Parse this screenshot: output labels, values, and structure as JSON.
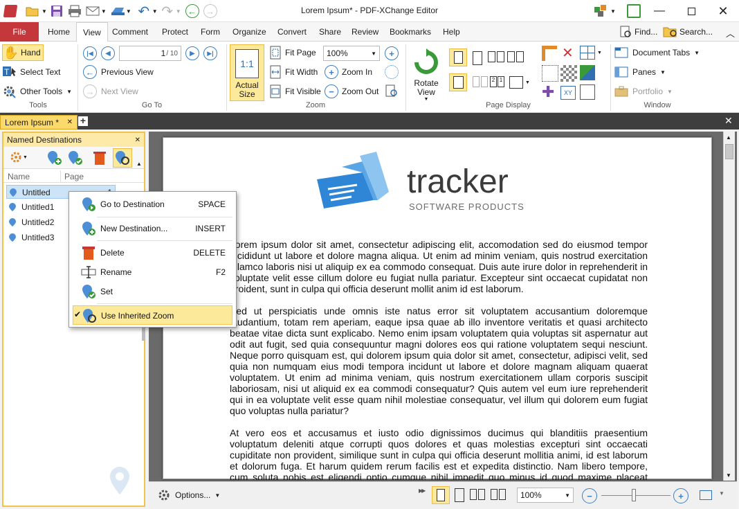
{
  "window": {
    "title": "Lorem Ipsum* - PDF-XChange Editor"
  },
  "ribbon_tabs": [
    "File",
    "Home",
    "View",
    "Comment",
    "Protect",
    "Form",
    "Organize",
    "Convert",
    "Share",
    "Review",
    "Bookmarks",
    "Help"
  ],
  "ribbon_right": {
    "find": "Find...",
    "search": "Search..."
  },
  "tools": {
    "hand": "Hand",
    "select_text": "Select Text",
    "other_tools": "Other Tools",
    "label": "Tools"
  },
  "goto": {
    "page_value": "1",
    "page_total": "/ 10",
    "previous_view": "Previous View",
    "next_view": "Next View",
    "label": "Go To"
  },
  "zoom": {
    "actual_size": "Actual Size",
    "fit_page": "Fit Page",
    "fit_width": "Fit Width",
    "fit_visible": "Fit Visible",
    "zoom_value": "100%",
    "zoom_in": "Zoom In",
    "zoom_out": "Zoom Out",
    "label": "Zoom"
  },
  "page_display": {
    "rotate_view": "Rotate View",
    "label": "Page Display"
  },
  "window_group": {
    "document_tabs": "Document Tabs",
    "panes": "Panes",
    "portfolio": "Portfolio",
    "label": "Window"
  },
  "document_tab": {
    "label": "Lorem Ipsum *"
  },
  "named_destinations": {
    "title": "Named Destinations",
    "col_name": "Name",
    "col_page": "Page",
    "rows": [
      {
        "name": "Untitled",
        "page": "1"
      },
      {
        "name": "Untitled1",
        "page": ""
      },
      {
        "name": "Untitled2",
        "page": ""
      },
      {
        "name": "Untitled3",
        "page": ""
      }
    ]
  },
  "context_menu": {
    "items": [
      {
        "label": "Go to Destination",
        "shortcut": "SPACE"
      },
      {
        "label": "New Destination...",
        "shortcut": "INSERT"
      },
      {
        "label": "Delete",
        "shortcut": "DELETE"
      },
      {
        "label": "Rename",
        "shortcut": "F2"
      },
      {
        "label": "Set",
        "shortcut": ""
      },
      {
        "label": "Use Inherited Zoom",
        "shortcut": "",
        "checked": true
      }
    ]
  },
  "document": {
    "logo_word": "tracker",
    "logo_sub": "SOFTWARE PRODUCTS",
    "paragraphs": [
      "Lorem ipsum dolor sit amet, consectetur adipiscing elit, accomodation sed do eiusmod tempor incididunt ut labore et dolore magna aliqua. Ut enim ad minim veniam, quis nostrud exercitation ullamco laboris nisi ut aliquip ex ea commodo consequat. Duis aute irure dolor in reprehenderit in voluptate velit esse cillum dolore eu fugiat nulla pariatur. Excepteur sint occaecat cupidatat non proident, sunt in culpa qui officia deserunt mollit anim id est laborum.",
      "Sed ut perspiciatis unde omnis iste natus error sit voluptatem accusantium doloremque laudantium, totam rem aperiam, eaque ipsa quae ab illo inventore veritatis et quasi architecto beatae vitae dicta sunt explicabo. Nemo enim ipsam voluptatem quia voluptas sit aspernatur aut odit aut fugit, sed quia consequuntur magni dolores eos qui ratione voluptatem sequi nesciunt. Neque porro quisquam est, qui dolorem ipsum quia dolor sit amet, consectetur, adipisci velit, sed quia non numquam eius modi tempora incidunt ut labore et dolore magnam aliquam quaerat voluptatem. Ut enim ad minima veniam, quis nostrum exercitationem ullam corporis suscipit laboriosam, nisi ut aliquid ex ea commodi consequatur? Quis autem vel eum iure reprehenderit qui in ea voluptate velit esse quam nihil molestiae consequatur, vel illum qui dolorem eum fugiat quo voluptas nulla pariatur?",
      "At vero eos et accusamus et iusto odio dignissimos ducimus qui blanditiis praesentium voluptatum deleniti atque corrupti quos dolores et quas molestias excepturi sint occaecati cupiditate non provident, similique sunt in culpa qui officia deserunt mollitia animi, id est laborum et dolorum fuga. Et harum quidem rerum facilis est et expedita distinctio. Nam libero tempore, cum soluta nobis est eligendi optio cumque nihil impedit quo minus id quod maxime placeat facere possimus, omnis"
    ]
  },
  "statusbar": {
    "options": "Options...",
    "zoom_value": "100%"
  },
  "colors": {
    "file_tab": "#c4383b",
    "accent_blue": "#3c7fc2",
    "selection_yellow": "#fde99a",
    "doc_background": "#6a6a6a"
  }
}
